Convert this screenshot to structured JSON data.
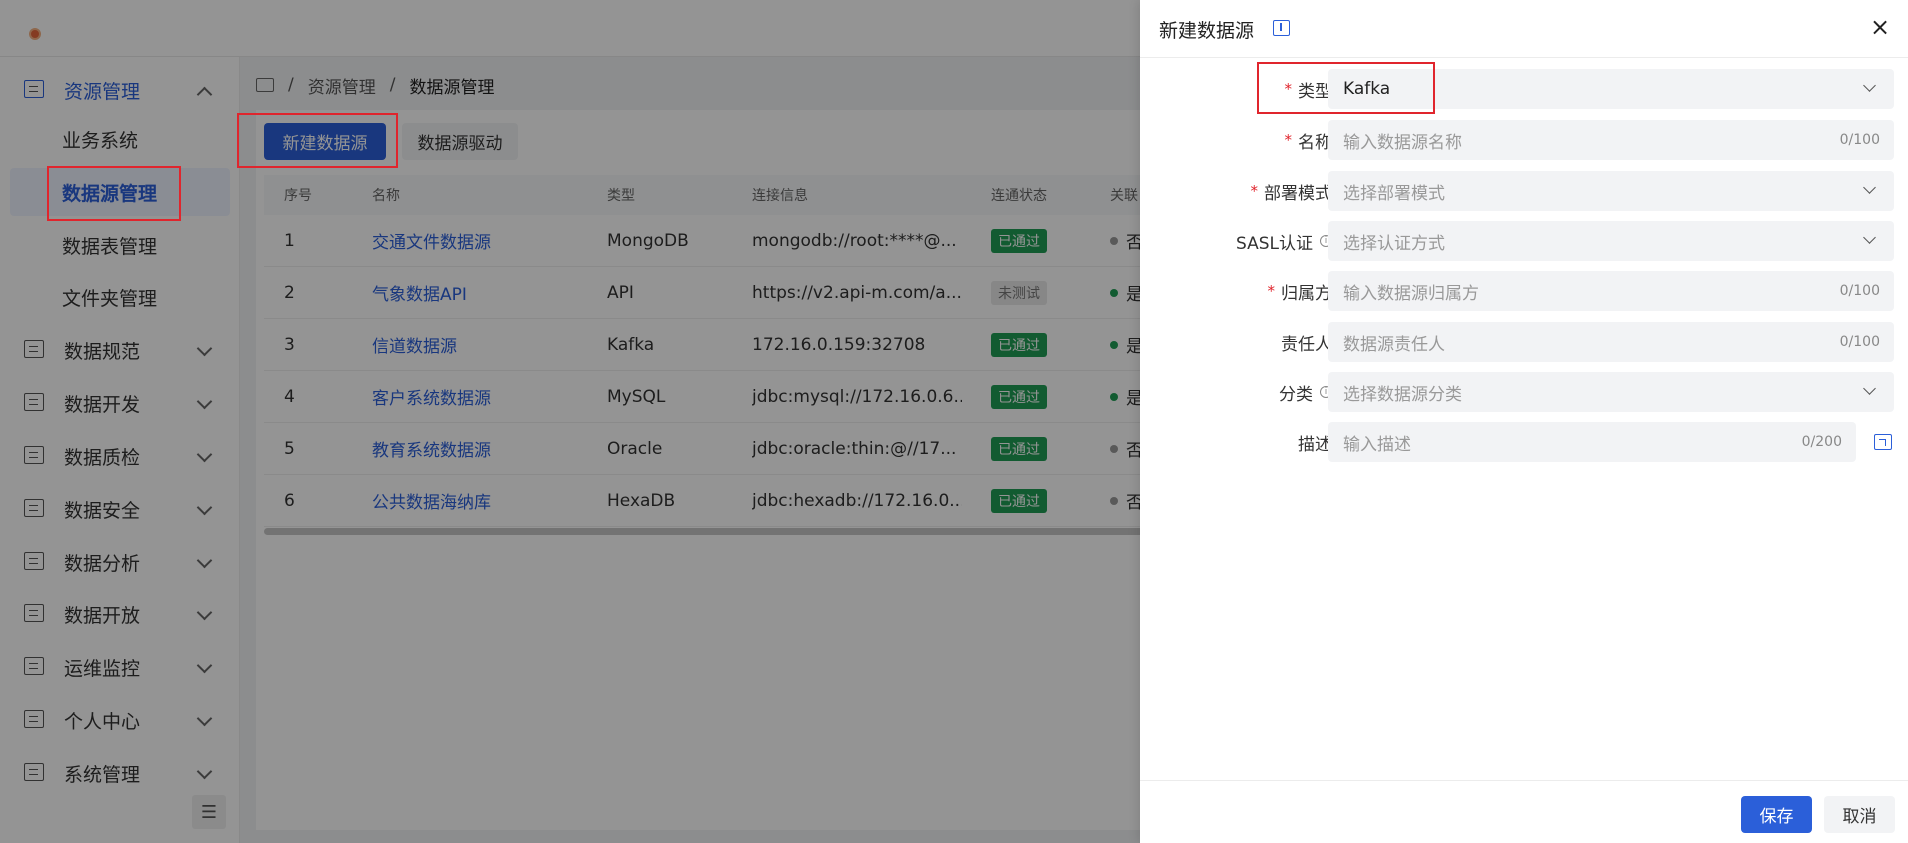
{
  "colors": {
    "primary": "#2b5fd9",
    "success": "#1f9d55",
    "danger": "#e0252d"
  },
  "sidebar": {
    "items": [
      {
        "label": "资源管理",
        "icon": "resource-icon",
        "expanded": true
      },
      {
        "label": "数据规范",
        "icon": "standard-icon"
      },
      {
        "label": "数据开发",
        "icon": "develop-icon"
      },
      {
        "label": "数据质检",
        "icon": "quality-icon"
      },
      {
        "label": "数据安全",
        "icon": "security-icon"
      },
      {
        "label": "数据分析",
        "icon": "analysis-icon"
      },
      {
        "label": "数据开放",
        "icon": "open-icon"
      },
      {
        "label": "运维监控",
        "icon": "monitor-icon"
      },
      {
        "label": "个人中心",
        "icon": "user-center-icon"
      },
      {
        "label": "系统管理",
        "icon": "system-icon"
      }
    ],
    "subitems": [
      "业务系统",
      "数据源管理",
      "数据表管理",
      "文件夹管理"
    ]
  },
  "breadcrumb": {
    "level1": "资源管理",
    "level2": "数据源管理"
  },
  "toolbar": {
    "new_label": "新建数据源",
    "driver_label": "数据源驱动"
  },
  "table": {
    "headers": {
      "no": "序号",
      "name": "名称",
      "type": "类型",
      "conn": "连接信息",
      "status": "连通状态",
      "rel": "关联"
    },
    "rows": [
      {
        "no": "1",
        "name": "交通文件数据源",
        "type": "MongoDB",
        "conn": "mongodb://root:****@...",
        "status": "已通过",
        "rel": "否"
      },
      {
        "no": "2",
        "name": "气象数据API",
        "type": "API",
        "conn": "https://v2.api-m.com/a...",
        "status": "未测试",
        "rel": "是"
      },
      {
        "no": "3",
        "name": "信道数据源",
        "type": "Kafka",
        "conn": "172.16.0.159:32708",
        "status": "已通过",
        "rel": "是"
      },
      {
        "no": "4",
        "name": "客户系统数据源",
        "type": "MySQL",
        "conn": "jdbc:mysql://172.16.0.6...",
        "status": "已通过",
        "rel": "是"
      },
      {
        "no": "5",
        "name": "教育系统数据源",
        "type": "Oracle",
        "conn": "jdbc:oracle:thin:@//17...",
        "status": "已通过",
        "rel": "否"
      },
      {
        "no": "6",
        "name": "公共数据海纳库",
        "type": "HexaDB",
        "conn": "jdbc:hexadb://172.16.0....",
        "status": "已通过",
        "rel": "否"
      }
    ]
  },
  "drawer": {
    "title": "新建数据源",
    "close": "×",
    "fields": {
      "type": {
        "label": "类型",
        "value": "Kafka"
      },
      "name": {
        "label": "名称",
        "placeholder": "输入数据源名称",
        "count": "0/100"
      },
      "deploy": {
        "label": "部署模式",
        "placeholder": "选择部署模式"
      },
      "sasl": {
        "label": "SASL认证",
        "placeholder": "选择认证方式"
      },
      "owner": {
        "label": "归属方",
        "placeholder": "输入数据源归属方",
        "count": "0/100"
      },
      "person": {
        "label": "责任人",
        "placeholder": "数据源责任人",
        "count": "0/100"
      },
      "category": {
        "label": "分类",
        "placeholder": "选择数据源分类"
      },
      "desc": {
        "label": "描述",
        "placeholder": "输入描述",
        "count": "0/200"
      }
    },
    "save_label": "保存",
    "cancel_label": "取消"
  }
}
